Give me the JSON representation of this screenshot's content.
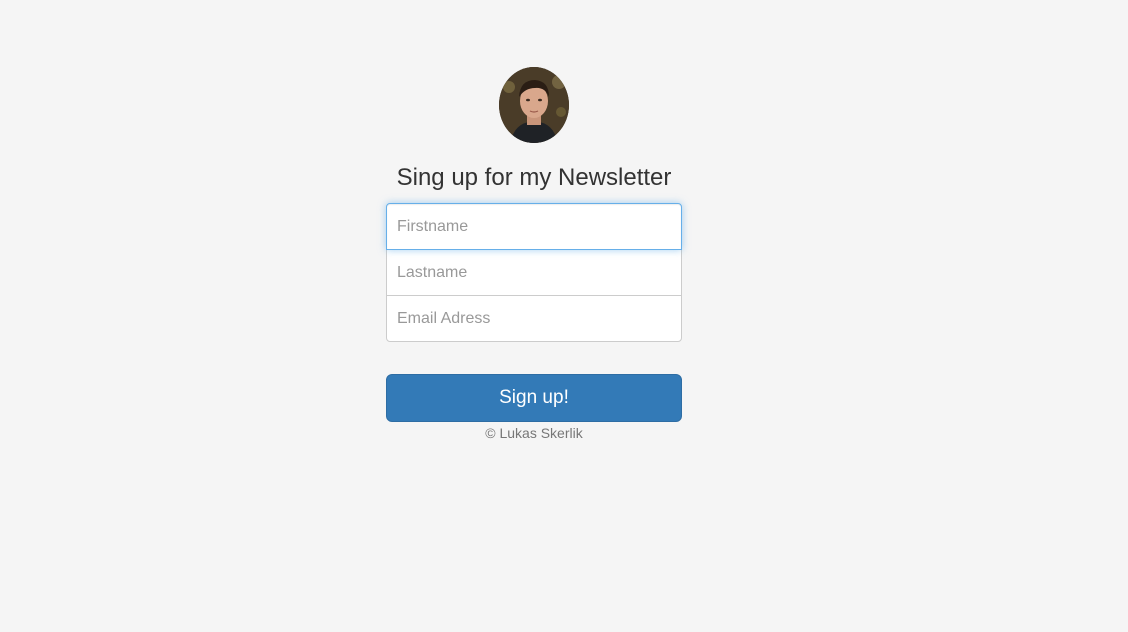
{
  "form": {
    "heading": "Sing up for my Newsletter",
    "firstname": {
      "placeholder": "Firstname",
      "value": ""
    },
    "lastname": {
      "placeholder": "Lastname",
      "value": ""
    },
    "email": {
      "placeholder": "Email Adress",
      "value": ""
    },
    "submit_label": "Sign up!",
    "copyright": "© Lukas Skerlik"
  },
  "colors": {
    "background": "#f5f5f5",
    "primary_button": "#337ab7",
    "focus_border": "#66afe9"
  }
}
